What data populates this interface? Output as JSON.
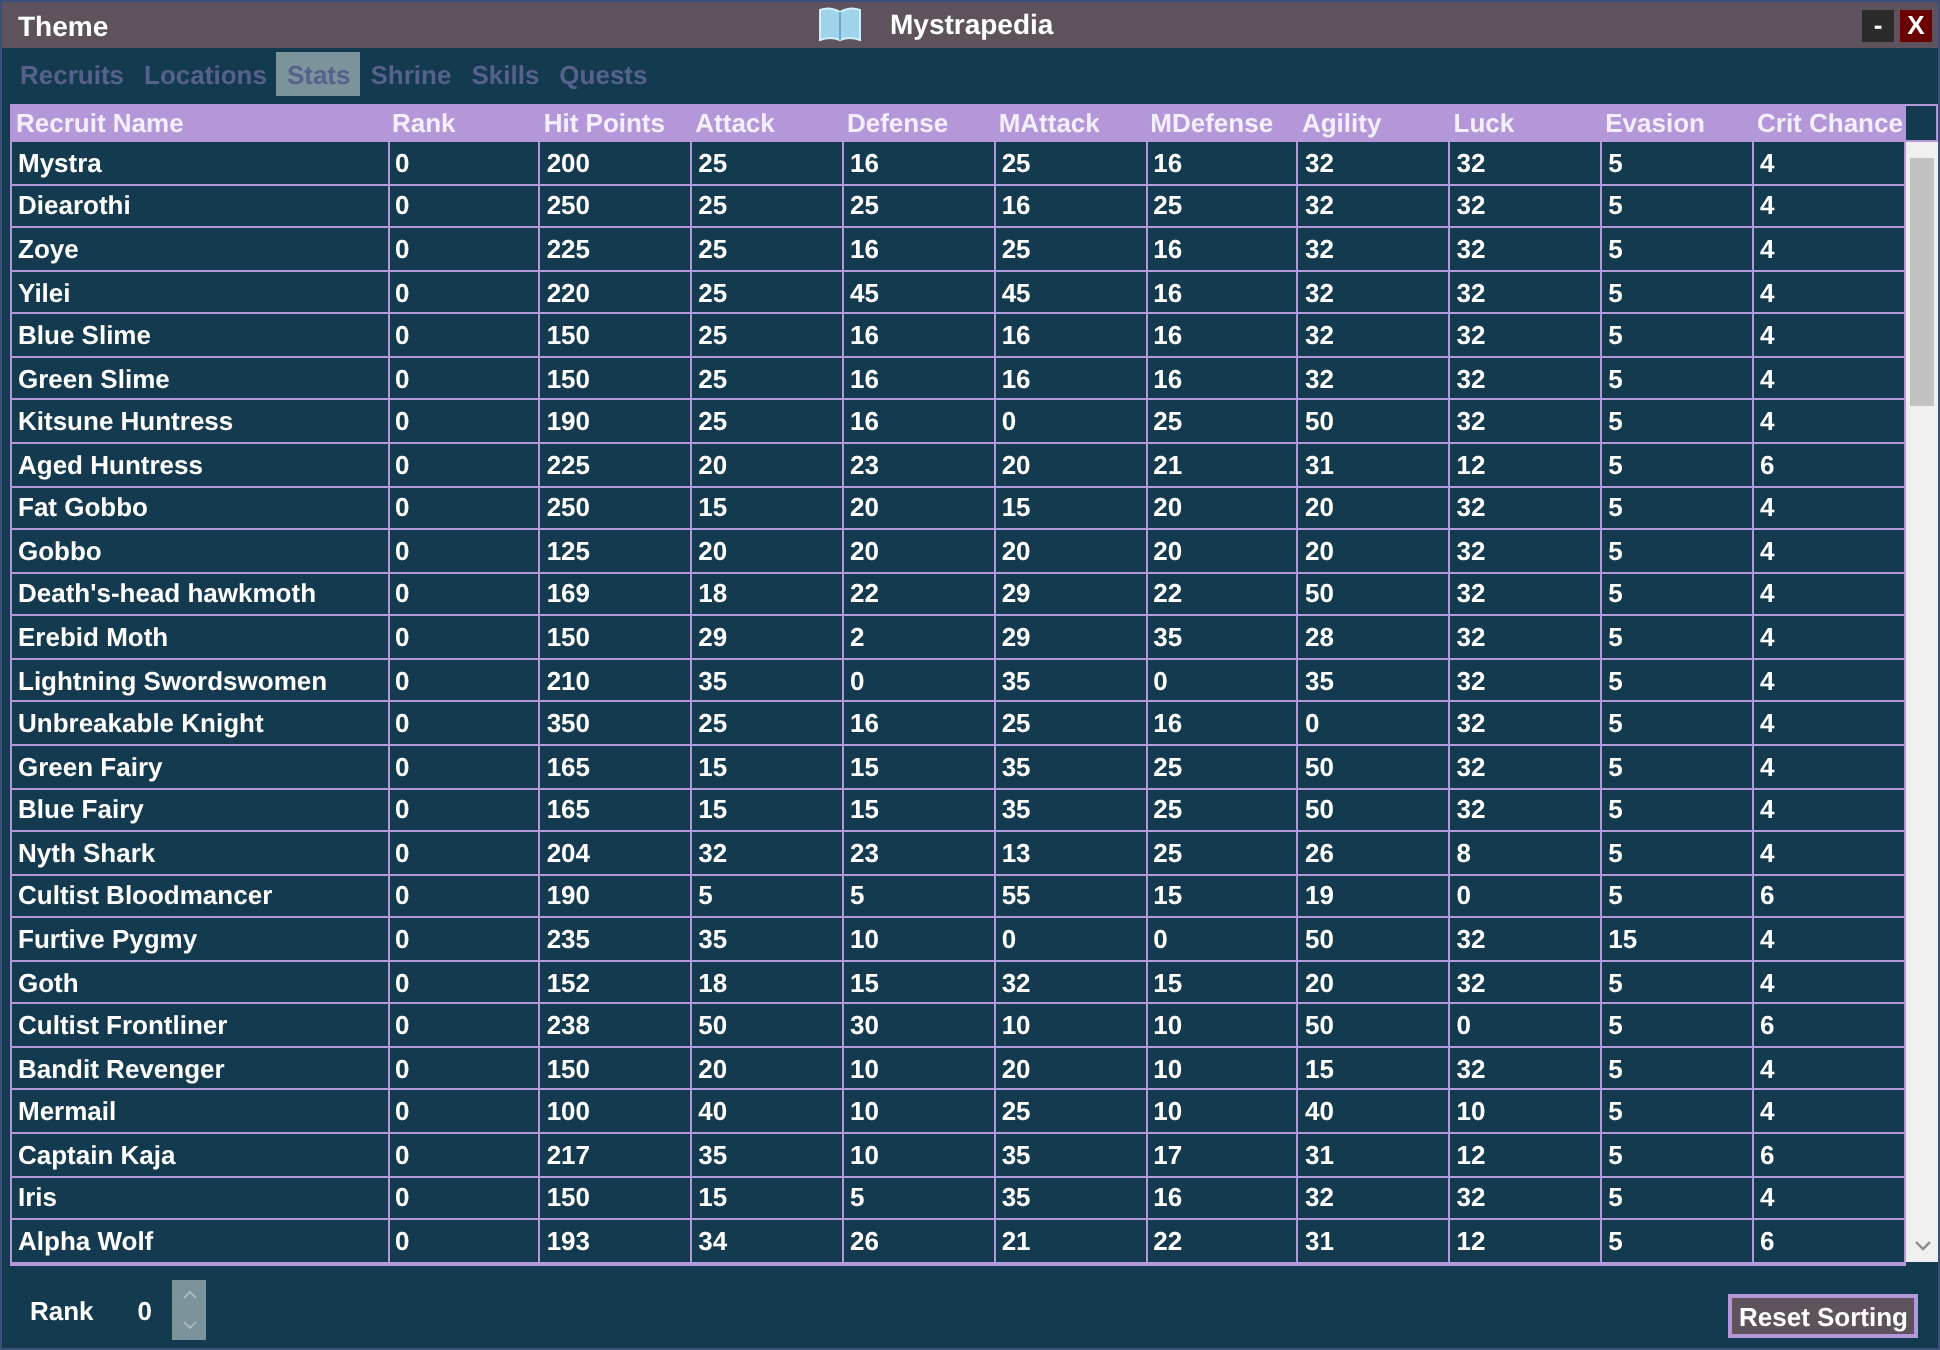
{
  "window": {
    "menu": "Theme",
    "title": "Mystrapedia",
    "minimize": "-",
    "close": "X"
  },
  "tabs": [
    {
      "label": "Recruits",
      "selected": false
    },
    {
      "label": "Locations",
      "selected": false
    },
    {
      "label": "Stats",
      "selected": true
    },
    {
      "label": "Shrine",
      "selected": false
    },
    {
      "label": "Skills",
      "selected": false
    },
    {
      "label": "Quests",
      "selected": false
    }
  ],
  "table": {
    "columns": [
      "Recruit Name",
      "Rank",
      "Hit Points",
      "Attack",
      "Defense",
      "MAttack",
      "MDefense",
      "Agility",
      "Luck",
      "Evasion",
      "Crit Chance"
    ],
    "rows": [
      [
        "Mystra",
        "0",
        "200",
        "25",
        "16",
        "25",
        "16",
        "32",
        "32",
        "5",
        "4"
      ],
      [
        "Diearothi",
        "0",
        "250",
        "25",
        "25",
        "16",
        "25",
        "32",
        "32",
        "5",
        "4"
      ],
      [
        "Zoye",
        "0",
        "225",
        "25",
        "16",
        "25",
        "16",
        "32",
        "32",
        "5",
        "4"
      ],
      [
        "Yilei",
        "0",
        "220",
        "25",
        "45",
        "45",
        "16",
        "32",
        "32",
        "5",
        "4"
      ],
      [
        "Blue Slime",
        "0",
        "150",
        "25",
        "16",
        "16",
        "16",
        "32",
        "32",
        "5",
        "4"
      ],
      [
        "Green Slime",
        "0",
        "150",
        "25",
        "16",
        "16",
        "16",
        "32",
        "32",
        "5",
        "4"
      ],
      [
        "Kitsune Huntress",
        "0",
        "190",
        "25",
        "16",
        "0",
        "25",
        "50",
        "32",
        "5",
        "4"
      ],
      [
        "Aged Huntress",
        "0",
        "225",
        "20",
        "23",
        "20",
        "21",
        "31",
        "12",
        "5",
        "6"
      ],
      [
        "Fat Gobbo",
        "0",
        "250",
        "15",
        "20",
        "15",
        "20",
        "20",
        "32",
        "5",
        "4"
      ],
      [
        "Gobbo",
        "0",
        "125",
        "20",
        "20",
        "20",
        "20",
        "20",
        "32",
        "5",
        "4"
      ],
      [
        "Death's-head hawkmoth",
        "0",
        "169",
        "18",
        "22",
        "29",
        "22",
        "50",
        "32",
        "5",
        "4"
      ],
      [
        "Erebid Moth",
        "0",
        "150",
        "29",
        "2",
        "29",
        "35",
        "28",
        "32",
        "5",
        "4"
      ],
      [
        "Lightning Swordswomen",
        "0",
        "210",
        "35",
        "0",
        "35",
        "0",
        "35",
        "32",
        "5",
        "4"
      ],
      [
        "Unbreakable Knight",
        "0",
        "350",
        "25",
        "16",
        "25",
        "16",
        "0",
        "32",
        "5",
        "4"
      ],
      [
        "Green Fairy",
        "0",
        "165",
        "15",
        "15",
        "35",
        "25",
        "50",
        "32",
        "5",
        "4"
      ],
      [
        "Blue Fairy",
        "0",
        "165",
        "15",
        "15",
        "35",
        "25",
        "50",
        "32",
        "5",
        "4"
      ],
      [
        "Nyth Shark",
        "0",
        "204",
        "32",
        "23",
        "13",
        "25",
        "26",
        "8",
        "5",
        "4"
      ],
      [
        "Cultist Bloodmancer",
        "0",
        "190",
        "5",
        "5",
        "55",
        "15",
        "19",
        "0",
        "5",
        "6"
      ],
      [
        "Furtive Pygmy",
        "0",
        "235",
        "35",
        "10",
        "0",
        "0",
        "50",
        "32",
        "15",
        "4"
      ],
      [
        "Goth",
        "0",
        "152",
        "18",
        "15",
        "32",
        "15",
        "20",
        "32",
        "5",
        "4"
      ],
      [
        "Cultist Frontliner",
        "0",
        "238",
        "50",
        "30",
        "10",
        "10",
        "50",
        "0",
        "5",
        "6"
      ],
      [
        "Bandit Revenger",
        "0",
        "150",
        "20",
        "10",
        "20",
        "10",
        "15",
        "32",
        "5",
        "4"
      ],
      [
        "Mermail",
        "0",
        "100",
        "40",
        "10",
        "25",
        "10",
        "40",
        "10",
        "5",
        "4"
      ],
      [
        "Captain Kaja",
        "0",
        "217",
        "35",
        "10",
        "35",
        "17",
        "31",
        "12",
        "5",
        "6"
      ],
      [
        "Iris",
        "0",
        "150",
        "15",
        "5",
        "35",
        "16",
        "32",
        "32",
        "5",
        "4"
      ],
      [
        "Alpha Wolf",
        "0",
        "193",
        "34",
        "26",
        "21",
        "22",
        "31",
        "12",
        "5",
        "6"
      ]
    ]
  },
  "footer": {
    "rank_label": "Rank",
    "rank_value": "0",
    "reset_button": "Reset Sorting"
  }
}
